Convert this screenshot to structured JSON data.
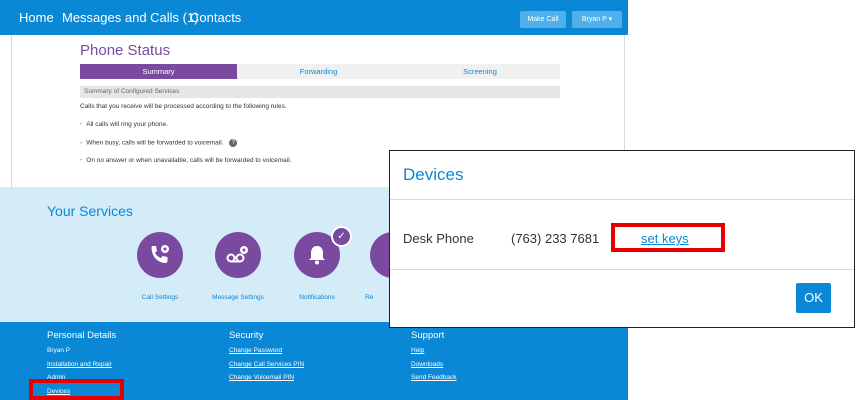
{
  "nav": {
    "home": "Home",
    "messages": "Messages and Calls (1)",
    "contacts": "Contacts",
    "make_call": "Make Call",
    "user": "Bryan P ▾"
  },
  "phone_status": {
    "title": "Phone Status",
    "tabs": [
      "Summary",
      "Forwarding",
      "Screening"
    ],
    "summary_header": "Summary of Configured Services",
    "intro": "Calls that you receive will be processed according to the following rules.",
    "rules": [
      "All calls will ring your phone.",
      "When busy, calls will be forwarded to voicemail.",
      "On no answer or when unavailable, calls will be forwarded to voicemail."
    ],
    "help_glyph": "?"
  },
  "services": {
    "title": "Your Services",
    "items": [
      {
        "label": "Call Settings",
        "icon": "phone-gear-icon"
      },
      {
        "label": "Message Settings",
        "icon": "voicemail-gear-icon"
      },
      {
        "label": "Notifications",
        "icon": "bell-icon"
      },
      {
        "label": "Re",
        "icon": "partial-service-icon"
      }
    ],
    "check_glyph": "✓"
  },
  "footer": {
    "personal": {
      "heading": "Personal Details",
      "name": "Bryan P",
      "installation": "Installation and Repair",
      "admin": "Admin",
      "devices": "Devices"
    },
    "security": {
      "heading": "Security",
      "links": [
        "Change Password",
        "Change Call Services PIN",
        "Change Voicemail PIN"
      ]
    },
    "support": {
      "heading": "Support",
      "links": [
        "Help",
        "Downloads",
        "Send Feedback"
      ]
    }
  },
  "dialog": {
    "title": "Devices",
    "device_name": "Desk Phone",
    "device_number": "(763) 233 7681",
    "set_keys": "set keys",
    "ok": "OK"
  },
  "colors": {
    "brand_blue": "#0a88d6",
    "purple": "#7a4aa0",
    "highlight_red": "#e60000",
    "services_bg": "#d4ebf8"
  }
}
